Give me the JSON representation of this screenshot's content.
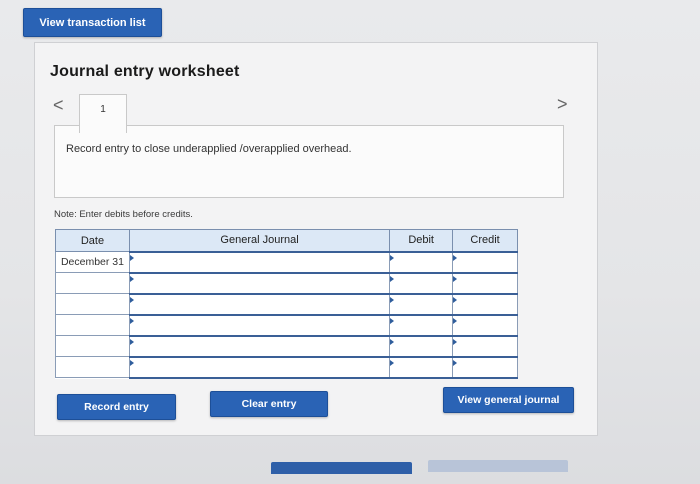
{
  "top": {
    "view_transaction_list": "View transaction list"
  },
  "worksheet": {
    "title": "Journal entry worksheet",
    "tab_number": "1",
    "nav_prev": "<",
    "nav_next": ">",
    "instruction": "Record entry to close underapplied /overapplied overhead.",
    "note": "Note: Enter debits before credits."
  },
  "table": {
    "headers": [
      "Date",
      "General Journal",
      "Debit",
      "Credit"
    ],
    "rows": [
      {
        "date": "December 31",
        "journal": "",
        "debit": "",
        "credit": ""
      },
      {
        "date": "",
        "journal": "",
        "debit": "",
        "credit": ""
      },
      {
        "date": "",
        "journal": "",
        "debit": "",
        "credit": ""
      },
      {
        "date": "",
        "journal": "",
        "debit": "",
        "credit": ""
      },
      {
        "date": "",
        "journal": "",
        "debit": "",
        "credit": ""
      },
      {
        "date": "",
        "journal": "",
        "debit": "",
        "credit": ""
      }
    ]
  },
  "buttons": {
    "record_entry": "Record entry",
    "clear_entry": "Clear entry",
    "view_general_journal": "View general journal"
  },
  "colors": {
    "button_blue": "#2a63b5",
    "header_bg": "#dce8f6"
  }
}
